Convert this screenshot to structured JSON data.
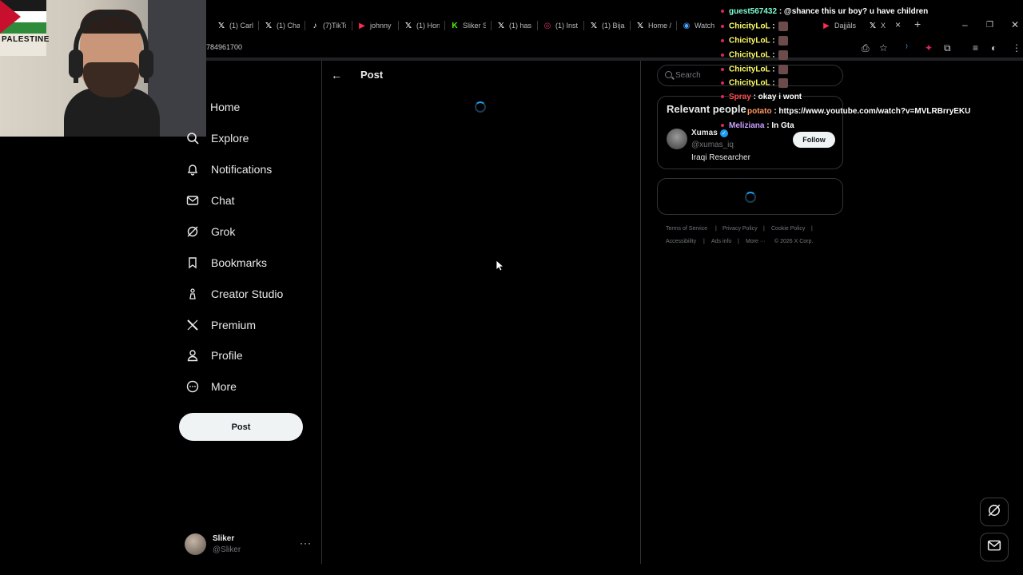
{
  "browser": {
    "tabs": [
      {
        "label": "(1) Carl",
        "icon": "x-logo-icon"
      },
      {
        "label": "(1) Cha",
        "icon": "x-logo-icon"
      },
      {
        "label": "(7)TikTo",
        "icon": "tiktok-icon"
      },
      {
        "label": "johnny",
        "icon": "youtube-icon"
      },
      {
        "label": "(1) Hon",
        "icon": "x-logo-icon"
      },
      {
        "label": "Sliker S",
        "icon": "kick-icon"
      },
      {
        "label": "(1) has",
        "icon": "x-logo-icon"
      },
      {
        "label": "(1) Inst",
        "icon": "instagram-icon"
      },
      {
        "label": "(1) Bija",
        "icon": "x-logo-icon"
      },
      {
        "label": "Home /",
        "icon": "x-logo-icon"
      },
      {
        "label": "Watch",
        "icon": "globe-icon"
      },
      {
        "label": "Dajjāls",
        "icon": "youtube-icon"
      },
      {
        "label": "X",
        "icon": "x-logo-icon"
      }
    ],
    "address": "784961700"
  },
  "chat_overlay": [
    {
      "user": "guest567432",
      "message": ": @shance this ur boy? u have children",
      "color": "#7fffd4"
    },
    {
      "user": "ChicityLoL",
      "message": ":",
      "color": "#ffff66"
    },
    {
      "user": "ChicityLoL",
      "message": ":",
      "color": "#ffff66"
    },
    {
      "user": "ChicityLoL",
      "message": ":",
      "color": "#ffff66"
    },
    {
      "user": "ChicityLoL",
      "message": ":",
      "color": "#ffff66"
    },
    {
      "user": "ChicityLoL",
      "message": ":",
      "color": "#ffff66"
    },
    {
      "user": "Spray",
      "message": ": okay i wont",
      "color": "#ff4d4d"
    },
    {
      "user": "potato",
      "message": ": https://www.youtube.com/watch?v=MVLRBrryEKU",
      "color": "#ff9966"
    },
    {
      "user": "Meliziana",
      "message": ": In Gta",
      "color": "#c9a0ff"
    }
  ],
  "nav": {
    "items": [
      {
        "label": "Home",
        "icon": "home-icon"
      },
      {
        "label": "Explore",
        "icon": "search-icon"
      },
      {
        "label": "Notifications",
        "icon": "bell-icon"
      },
      {
        "label": "Chat",
        "icon": "mail-icon"
      },
      {
        "label": "Grok",
        "icon": "grok-icon"
      },
      {
        "label": "Bookmarks",
        "icon": "bookmark-icon"
      },
      {
        "label": "Creator Studio",
        "icon": "flask-icon"
      },
      {
        "label": "Premium",
        "icon": "x-logo-icon"
      },
      {
        "label": "Profile",
        "icon": "person-icon"
      },
      {
        "label": "More",
        "icon": "more-circle-icon"
      }
    ],
    "post_button": "Post"
  },
  "account": {
    "name": "Sliker",
    "handle": "@Sliker",
    "more": "···"
  },
  "main": {
    "title": "Post",
    "back": "←"
  },
  "sidebar": {
    "search_placeholder": "Search",
    "relevant_title": "Relevant people",
    "person": {
      "name": "Xumas",
      "handle": "@xumas_iq",
      "bio": "Iraqi Researcher",
      "follow_label": "Follow"
    },
    "footer": {
      "terms": "Terms of Service",
      "privacy": "Privacy Policy",
      "cookie": "Cookie Policy",
      "accessibility": "Accessibility",
      "ads": "Ads info",
      "more": "More ···",
      "copyright": "© 2026 X Corp."
    }
  },
  "colors": {
    "accent": "#1d9bf0",
    "background": "#000000",
    "border": "#2f3336",
    "muted": "#71767b"
  }
}
